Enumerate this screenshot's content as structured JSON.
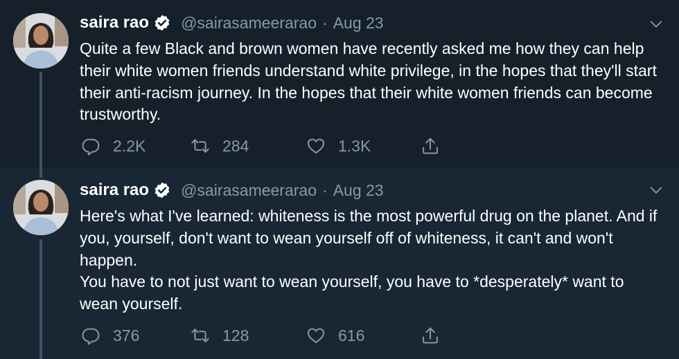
{
  "tweets": [
    {
      "author": {
        "name": "saira rao",
        "handle": "@sairasameerarao",
        "verified": true
      },
      "separator": "·",
      "date": "Aug 23",
      "text": [
        "Quite a few Black and brown women have recently asked me how they can help their white women friends understand white privilege, in the hopes that they'll start their anti-racism journey. In the hopes that their white women friends can become trustworthy."
      ],
      "stats": {
        "replies": "2.2K",
        "retweets": "284",
        "likes": "1.3K"
      }
    },
    {
      "author": {
        "name": "saira rao",
        "handle": "@sairasameerarao",
        "verified": true
      },
      "separator": "·",
      "date": "Aug 23",
      "text": [
        "Here's what I've learned: whiteness is the most powerful drug on the planet. And if you, yourself, don't want to wean yourself off of whiteness, it can't and won't happen.",
        "You have to not just want to wean yourself, you have to *desperately* want to wean yourself."
      ],
      "stats": {
        "replies": "376",
        "retweets": "128",
        "likes": "616"
      }
    }
  ],
  "icons": {
    "verified": "verified-badge-icon",
    "more": "chevron-down-icon",
    "reply": "reply-icon",
    "retweet": "retweet-icon",
    "like": "heart-icon",
    "share": "share-icon"
  },
  "colors": {
    "background": "#15202b",
    "background_alt": "#192734",
    "text": "#ffffff",
    "secondary_text": "#8899a6",
    "thread_line": "#3d5466"
  }
}
